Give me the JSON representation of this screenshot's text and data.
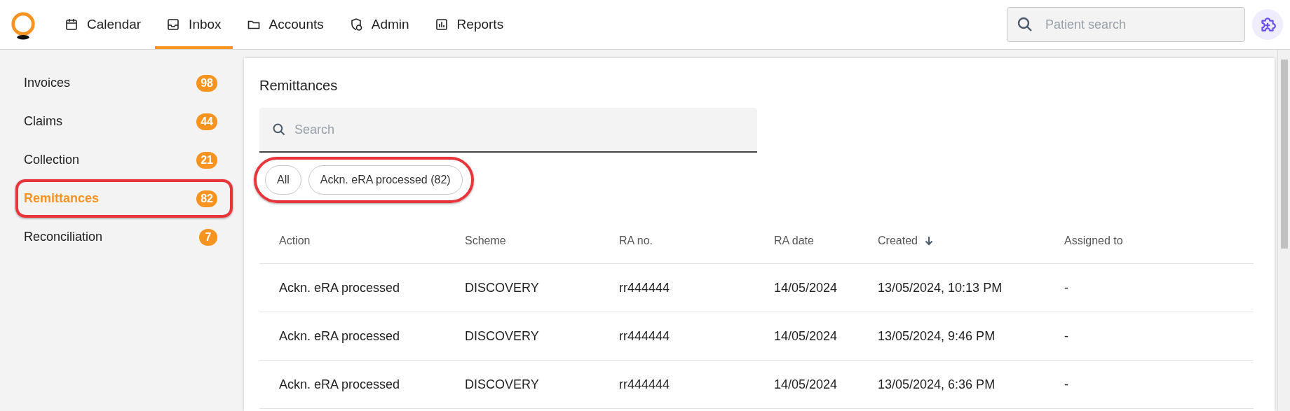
{
  "nav": [
    {
      "label": "Calendar",
      "selected": false
    },
    {
      "label": "Inbox",
      "selected": true
    },
    {
      "label": "Accounts",
      "selected": false
    },
    {
      "label": "Admin",
      "selected": false
    },
    {
      "label": "Reports",
      "selected": false
    }
  ],
  "patient_search": {
    "placeholder": "Patient search"
  },
  "sidebar": {
    "items": [
      {
        "label": "Invoices",
        "count": "98",
        "selected": false,
        "annotated": false
      },
      {
        "label": "Claims",
        "count": "44",
        "selected": false,
        "annotated": false
      },
      {
        "label": "Collection",
        "count": "21",
        "selected": false,
        "annotated": false
      },
      {
        "label": "Remittances",
        "count": "82",
        "selected": true,
        "annotated": true
      },
      {
        "label": "Reconciliation",
        "count": "7",
        "selected": false,
        "annotated": false
      }
    ]
  },
  "main": {
    "title": "Remittances",
    "search": {
      "placeholder": "Search"
    },
    "filters": {
      "annotated": true,
      "chips": [
        {
          "label": "All"
        },
        {
          "label": "Ackn. eRA processed (82)"
        }
      ]
    },
    "table": {
      "columns": [
        {
          "label": "Action",
          "sorted": false
        },
        {
          "label": "Scheme",
          "sorted": false
        },
        {
          "label": "RA no.",
          "sorted": false
        },
        {
          "label": "RA date",
          "sorted": false
        },
        {
          "label": "Created",
          "sorted": true
        },
        {
          "label": "Assigned to",
          "sorted": false
        }
      ],
      "rows": [
        [
          "Ackn. eRA processed",
          "DISCOVERY",
          "rr444444",
          "14/05/2024",
          "13/05/2024, 10:13 PM",
          "-"
        ],
        [
          "Ackn. eRA processed",
          "DISCOVERY",
          "rr444444",
          "14/05/2024",
          "13/05/2024, 9:46 PM",
          "-"
        ],
        [
          "Ackn. eRA processed",
          "DISCOVERY",
          "rr444444",
          "14/05/2024",
          "13/05/2024, 6:36 PM",
          "-"
        ]
      ]
    }
  }
}
